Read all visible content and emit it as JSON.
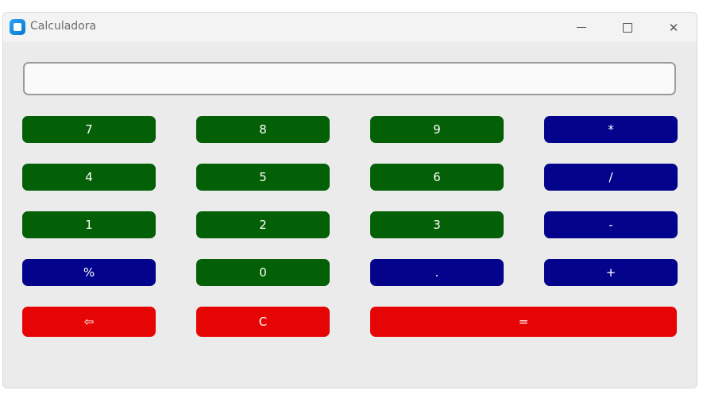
{
  "window": {
    "title": "Calculadora",
    "icon": "calculator-app-icon",
    "controls": {
      "minimize": "minimize-icon",
      "maximize": "maximize-icon",
      "close": "✕"
    }
  },
  "display": {
    "value": "",
    "placeholder": ""
  },
  "colors": {
    "digit": "#046006",
    "operator": "#03038c",
    "action": "#e60505",
    "background": "#ebebeb"
  },
  "keys": {
    "k7": "7",
    "k8": "8",
    "k9": "9",
    "multiply": "*",
    "k4": "4",
    "k5": "5",
    "k6": "6",
    "divide": "/",
    "k1": "1",
    "k2": "2",
    "k3": "3",
    "minus": "-",
    "percent": "%",
    "k0": "0",
    "dot": ".",
    "plus": "+",
    "backspace": "⇦",
    "clear": "C",
    "equals": "="
  }
}
